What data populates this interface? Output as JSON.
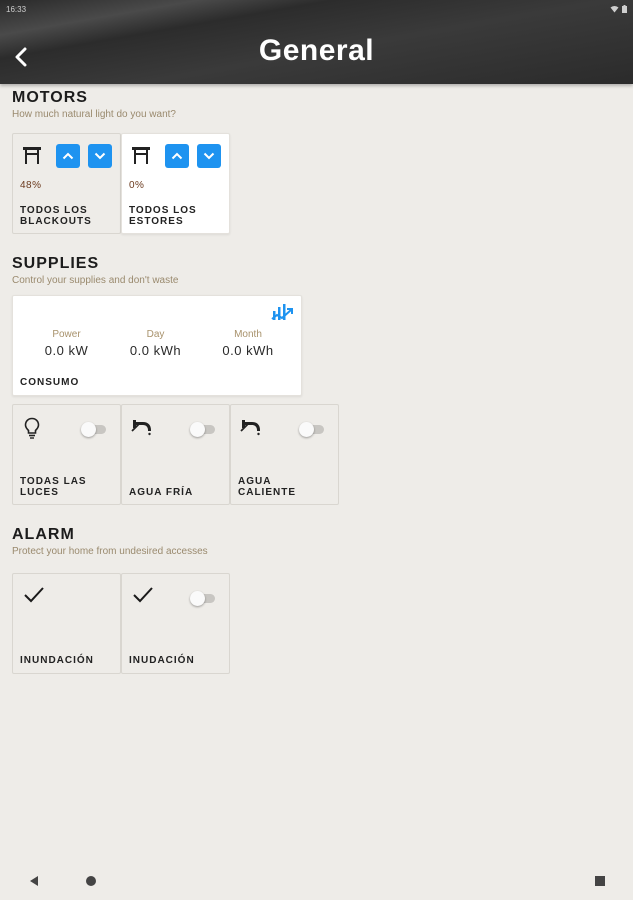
{
  "status": {
    "time": "16:33"
  },
  "header": {
    "title": "General",
    "back_icon": "chevron-left-icon"
  },
  "motors": {
    "title": "MOTORS",
    "subtitle": "How much natural light do you want?",
    "tiles": [
      {
        "percent": "48%",
        "label_line1": "TODOS LOS",
        "label_line2": "BLACKOUTS"
      },
      {
        "percent": "0%",
        "label_line1": "TODOS LOS",
        "label_line2": "ESTORES"
      }
    ]
  },
  "supplies": {
    "title": "SUPPLIES",
    "subtitle": "Control your supplies and don't waste",
    "consumo": {
      "label": "CONSUMO",
      "power_label": "Power",
      "power_value": "0.0 kW",
      "day_label": "Day",
      "day_value": "0.0 kWh",
      "month_label": "Month",
      "month_value": "0.0 kWh"
    },
    "switches": [
      {
        "label_line1": "TODAS LAS",
        "label_line2": "LUCES",
        "icon": "bulb-icon",
        "on": false
      },
      {
        "label_line1": "AGUA FRÍA",
        "label_line2": "",
        "icon": "faucet-icon",
        "on": false
      },
      {
        "label_line1": "AGUA",
        "label_line2": "CALIENTE",
        "icon": "faucet-icon",
        "on": false
      }
    ]
  },
  "alarm": {
    "title": "ALARM",
    "subtitle": "Protect your home from undesired accesses",
    "tiles": [
      {
        "label": "INUNDACIÓN",
        "icon": "check-icon"
      },
      {
        "label": "INUDACIÓN",
        "icon": "check-icon",
        "on": false
      }
    ]
  },
  "colors": {
    "accent_blue": "#1e93f0",
    "header_bg": "#2f2f2f",
    "background": "#eeece8",
    "subtitle": "#9a8a6e",
    "percent": "#6b3a1e"
  }
}
